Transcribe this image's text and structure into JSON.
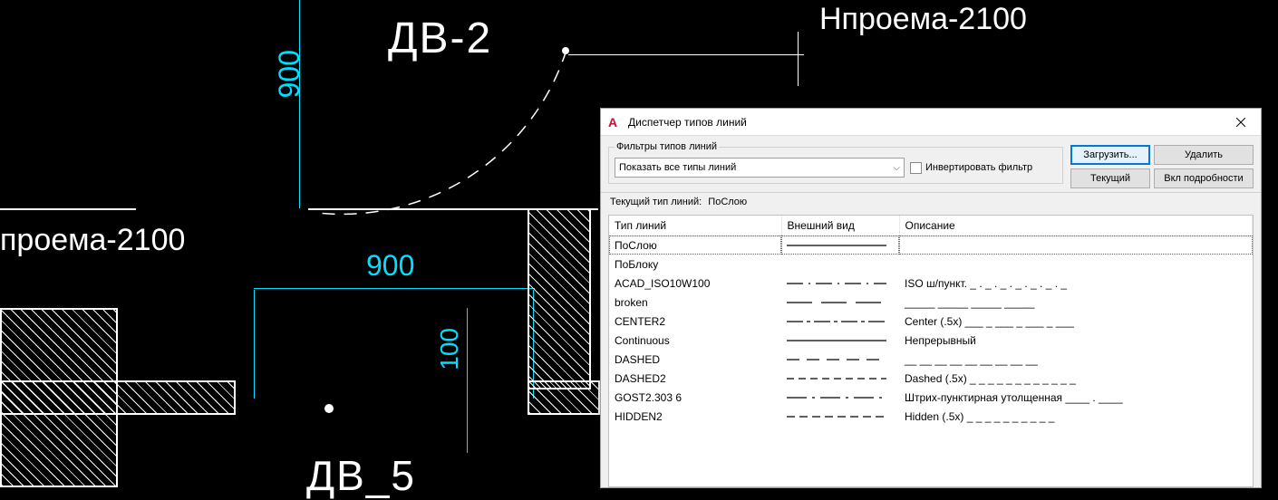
{
  "cad": {
    "label_dv2": "ДВ-2",
    "label_dv5": "ДВ_5",
    "label_h_proema_left": "проема-2100",
    "label_h_proema_right": "Нпроема-2100",
    "dim_900_v": "900",
    "dim_900_h": "900",
    "dim_100": "100"
  },
  "dialog": {
    "app_icon_letter": "A",
    "title": "Диспетчер типов линий",
    "filter": {
      "legend": "Фильтры типов линий",
      "select_value": "Показать все типы линий",
      "invert_label": "Инвертировать фильтр"
    },
    "buttons": {
      "load": "Загрузить...",
      "delete": "Удалить",
      "current": "Текущий",
      "details": "Вкл подробности"
    },
    "current_label": "Текущий тип линий:",
    "current_value": "ПоСлою",
    "columns": {
      "name": "Тип линий",
      "appearance": "Внешний вид",
      "description": "Описание"
    },
    "rows": [
      {
        "name": "ПоСлою",
        "pattern": "solid",
        "desc": "",
        "selected": true
      },
      {
        "name": "ПоБлоку",
        "pattern": "none",
        "desc": ""
      },
      {
        "name": "ACAD_ISO10W100",
        "pattern": "dashdot",
        "desc": "ISO ш/пункт. _ . _ . _ . _ . _ . _ . _"
      },
      {
        "name": "broken",
        "pattern": "dash-long",
        "desc": "_____  _____  _____  _____"
      },
      {
        "name": "CENTER2",
        "pattern": "center2",
        "desc": "Center (.5x) ___ _ ___ _ ___ _ ___"
      },
      {
        "name": "Continuous",
        "pattern": "solid",
        "desc": "Непрерывный"
      },
      {
        "name": "DASHED",
        "pattern": "dashed",
        "desc": "__ __ __ __ __ __ __ __ __"
      },
      {
        "name": "DASHED2",
        "pattern": "dashed2",
        "desc": "Dashed (.5x) _ _ _ _ _ _ _ _ _ _ _ _"
      },
      {
        "name": "GOST2.303 6",
        "pattern": "gost",
        "desc": "Штрих-пунктирная утолщенная ____  .  ____"
      },
      {
        "name": "HIDDEN2",
        "pattern": "hidden2",
        "desc": "Hidden (.5x) _ _ _ _ _ _ _ _ _ _"
      }
    ]
  }
}
